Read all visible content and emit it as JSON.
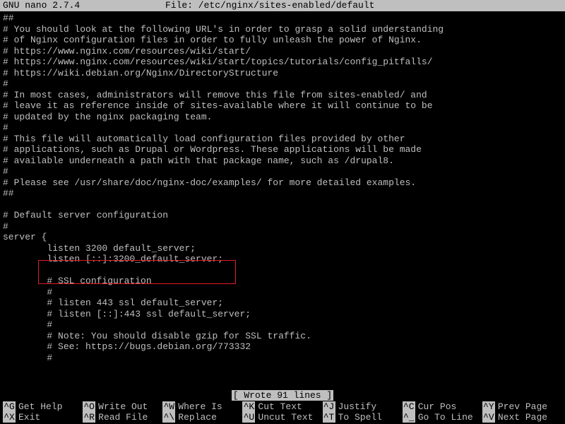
{
  "titlebar": {
    "app": "  GNU nano 2.7.4",
    "file_label": "File: /etc/nginx/sites-enabled/default"
  },
  "lines": [
    "##",
    "# You should look at the following URL's in order to grasp a solid understanding",
    "# of Nginx configuration files in order to fully unleash the power of Nginx.",
    "# https://www.nginx.com/resources/wiki/start/",
    "# https://www.nginx.com/resources/wiki/start/topics/tutorials/config_pitfalls/",
    "# https://wiki.debian.org/Nginx/DirectoryStructure",
    "#",
    "# In most cases, administrators will remove this file from sites-enabled/ and",
    "# leave it as reference inside of sites-available where it will continue to be",
    "# updated by the nginx packaging team.",
    "#",
    "# This file will automatically load configuration files provided by other",
    "# applications, such as Drupal or Wordpress. These applications will be made",
    "# available underneath a path with that package name, such as /drupal8.",
    "#",
    "# Please see /usr/share/doc/nginx-doc/examples/ for more detailed examples.",
    "##",
    "",
    "# Default server configuration",
    "#",
    "server {",
    "        listen 3200 default_server;",
    "        listen [::]:3200_default_server;",
    "",
    "        # SSL configuration",
    "        #",
    "        # listen 443 ssl default_server;",
    "        # listen [::]:443 ssl default_server;",
    "        #",
    "        # Note: You should disable gzip for SSL traffic.",
    "        # See: https://bugs.debian.org/773332",
    "        #"
  ],
  "status": "[ Wrote 91 lines ]",
  "shortcuts": {
    "row1": [
      {
        "key": "^G",
        "label": "Get Help"
      },
      {
        "key": "^O",
        "label": "Write Out"
      },
      {
        "key": "^W",
        "label": "Where Is"
      },
      {
        "key": "^K",
        "label": "Cut Text"
      },
      {
        "key": "^J",
        "label": "Justify"
      },
      {
        "key": "^C",
        "label": "Cur Pos"
      },
      {
        "key": "^Y",
        "label": "Prev Page"
      }
    ],
    "row2": [
      {
        "key": "^X",
        "label": "Exit"
      },
      {
        "key": "^R",
        "label": "Read File"
      },
      {
        "key": "^\\",
        "label": "Replace"
      },
      {
        "key": "^U",
        "label": "Uncut Text"
      },
      {
        "key": "^T",
        "label": "To Spell"
      },
      {
        "key": "^_",
        "label": "Go To Line"
      },
      {
        "key": "^V",
        "label": "Next Page"
      }
    ]
  }
}
